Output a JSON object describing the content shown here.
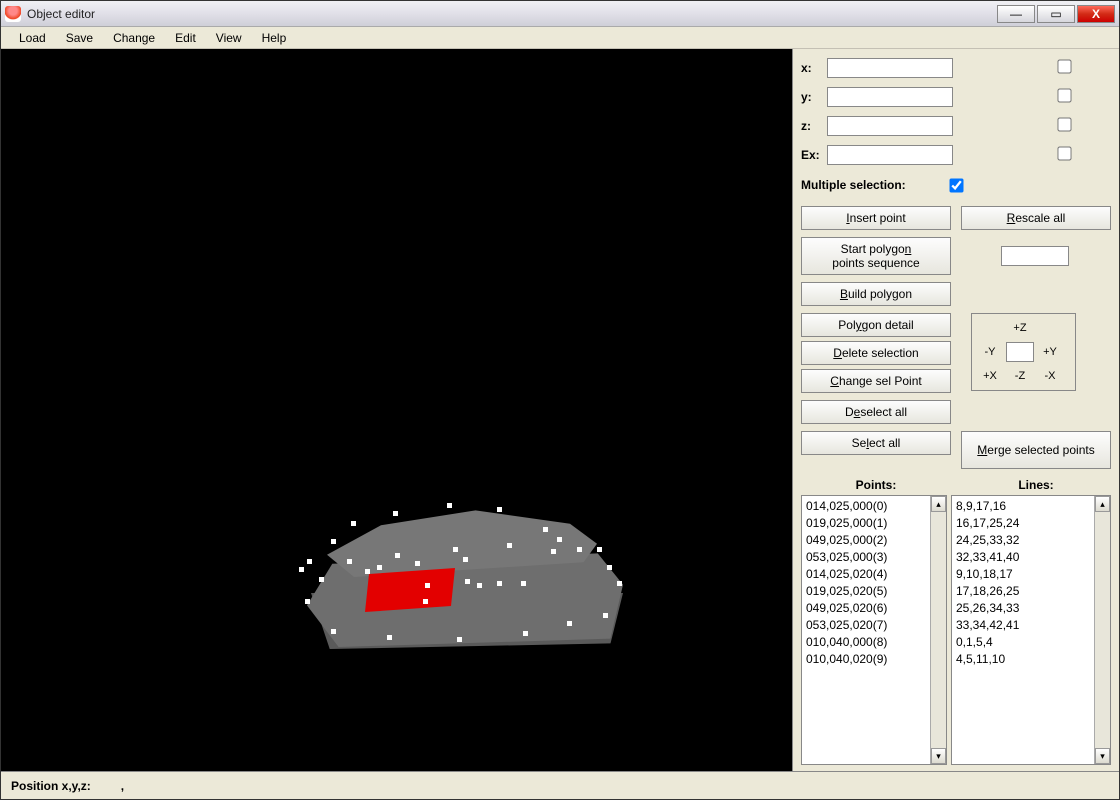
{
  "window": {
    "title": "Object editor"
  },
  "menu": {
    "load": "Load",
    "save": "Save",
    "change": "Change",
    "edit": "Edit",
    "view": "View",
    "help": "Help"
  },
  "coords": {
    "x_label": "x:",
    "y_label": "y:",
    "z_label": "z:",
    "ex_label": "Ex:",
    "x_value": "",
    "y_value": "",
    "z_value": "",
    "ex_value": ""
  },
  "multi": {
    "label": "Multiple selection:",
    "checked": true
  },
  "buttons": {
    "insert_point_pre": "",
    "insert_point_u": "I",
    "insert_point_post": "nsert point",
    "rescale_pre": "",
    "rescale_u": "R",
    "rescale_post": "escale all",
    "seq_pre": "Start polygo",
    "seq_u": "n",
    "seq_post": " points sequence",
    "build_pre": "",
    "build_u": "B",
    "build_post": "uild polygon",
    "detail_pre": "Pol",
    "detail_u": "y",
    "detail_post": "gon detail",
    "delete_pre": "",
    "delete_u": "D",
    "delete_post": "elete selection",
    "change_sel_pre": "",
    "change_sel_u": "C",
    "change_sel_post": "hange sel Point",
    "deselect_pre": "D",
    "deselect_u": "e",
    "deselect_post": "select all",
    "select_all_pre": "Se",
    "select_all_u": "l",
    "select_all_post": "ect all",
    "merge_pre": "",
    "merge_u": "M",
    "merge_post": "erge selected points"
  },
  "nudge": {
    "plus_z": "+Z",
    "minus_y": "-Y",
    "plus_y": "+Y",
    "plus_x": "+X",
    "minus_z": "-Z",
    "minus_x": "-X",
    "value": ""
  },
  "lists": {
    "points_header": "Points:",
    "lines_header": "Lines:",
    "points": [
      "014,025,000(0)",
      "019,025,000(1)",
      "049,025,000(2)",
      "053,025,000(3)",
      "014,025,020(4)",
      "019,025,020(5)",
      "049,025,020(6)",
      "053,025,020(7)",
      "010,040,000(8)",
      "010,040,020(9)"
    ],
    "lines": [
      "8,9,17,16",
      "16,17,25,24",
      "24,25,33,32",
      "32,33,41,40",
      "9,10,18,17",
      "17,18,26,25",
      "25,26,34,33",
      "33,34,42,41",
      "0,1,5,4",
      "4,5,11,10"
    ]
  },
  "status": {
    "label": "Position x,y,z:",
    "value": ","
  },
  "vertices": [
    [
      24,
      36
    ],
    [
      44,
      18
    ],
    [
      86,
      8
    ],
    [
      140,
      0
    ],
    [
      190,
      4
    ],
    [
      236,
      24
    ],
    [
      250,
      34
    ],
    [
      270,
      44
    ],
    [
      -8,
      64
    ],
    [
      0,
      56
    ],
    [
      290,
      44
    ],
    [
      300,
      62
    ],
    [
      310,
      78
    ],
    [
      296,
      110
    ],
    [
      -2,
      96
    ],
    [
      12,
      74
    ],
    [
      40,
      56
    ],
    [
      88,
      50
    ],
    [
      146,
      44
    ],
    [
      200,
      40
    ],
    [
      244,
      46
    ],
    [
      24,
      126
    ],
    [
      80,
      132
    ],
    [
      150,
      134
    ],
    [
      216,
      128
    ],
    [
      260,
      118
    ],
    [
      58,
      66
    ],
    [
      70,
      62
    ],
    [
      108,
      58
    ],
    [
      118,
      80
    ],
    [
      158,
      76
    ],
    [
      170,
      80
    ],
    [
      214,
      78
    ],
    [
      190,
      78
    ],
    [
      156,
      54
    ],
    [
      116,
      96
    ]
  ]
}
